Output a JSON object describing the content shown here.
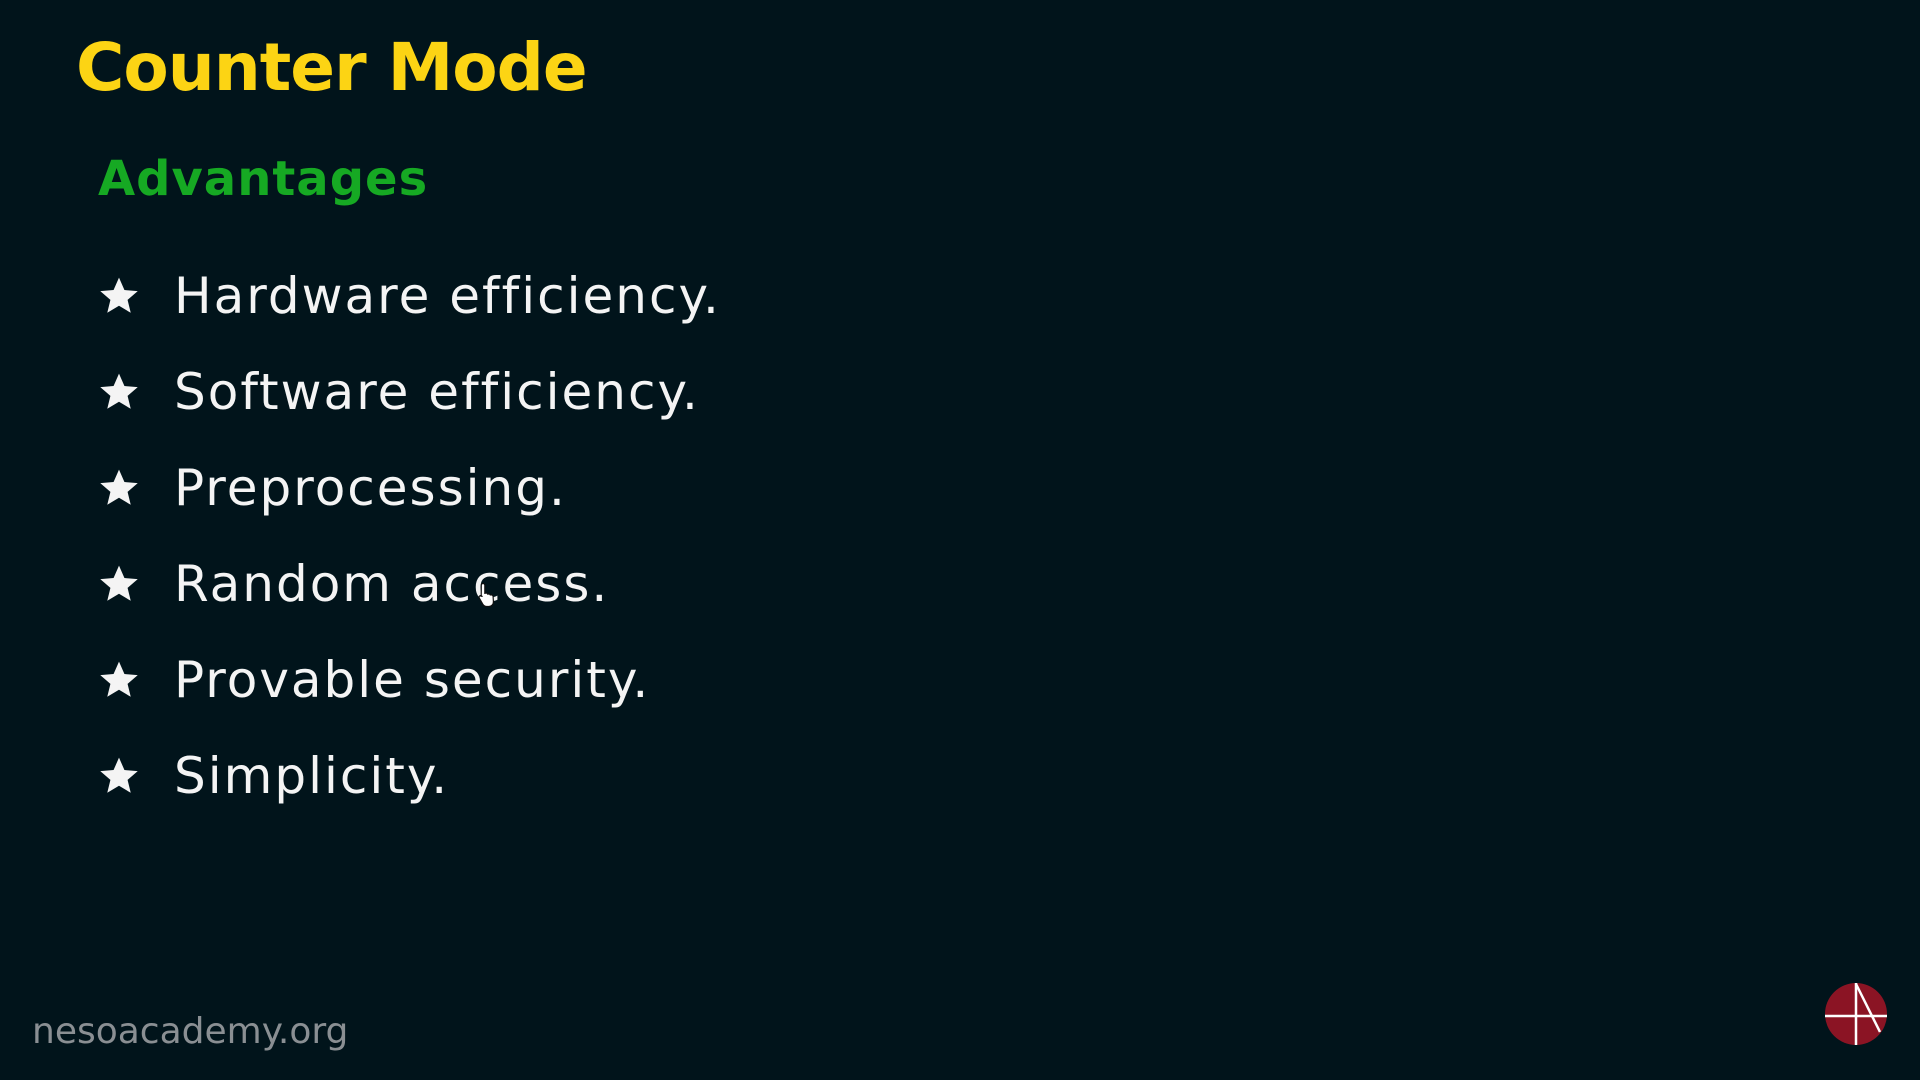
{
  "slide": {
    "title": "Counter Mode",
    "subtitle": "Advantages",
    "items": [
      {
        "label": "Hardware efficiency.",
        "icon": "star-icon"
      },
      {
        "label": "Software efficiency.",
        "icon": "star-icon"
      },
      {
        "label": "Preprocessing.",
        "icon": "star-icon"
      },
      {
        "label": "Random access.",
        "icon": "star-icon"
      },
      {
        "label": "Provable security.",
        "icon": "star-icon"
      },
      {
        "label": "Simplicity.",
        "icon": "star-icon"
      }
    ],
    "watermark": "nesoacademy.org",
    "logo_icon": "neso-academy-logo-icon",
    "cursor_icon": "hand-pointer-icon"
  },
  "colors": {
    "background": "#01141b",
    "title": "#fcd414",
    "subtitle": "#16a923",
    "text": "#f4f4f4",
    "watermark": "#8a8f93",
    "logo": "#8b1424"
  }
}
